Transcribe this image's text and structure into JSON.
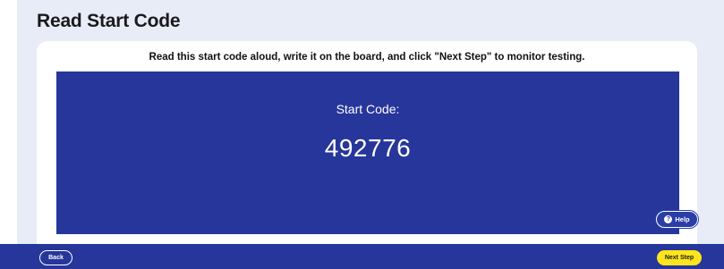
{
  "page": {
    "title": "Read Start Code",
    "instruction": "Read this start code aloud, write it on the board, and click \"Next Step\" to monitor testing."
  },
  "code_panel": {
    "label": "Start Code:",
    "value": "492776"
  },
  "help": {
    "label": "Help",
    "icon": "question-circle-icon",
    "icon_glyph": "?"
  },
  "footer": {
    "back_label": "Back",
    "next_label": "Next Step"
  },
  "colors": {
    "panel_blue": "#26369a",
    "background": "#e8ecf7",
    "next_button_yellow": "#ffe51c"
  }
}
